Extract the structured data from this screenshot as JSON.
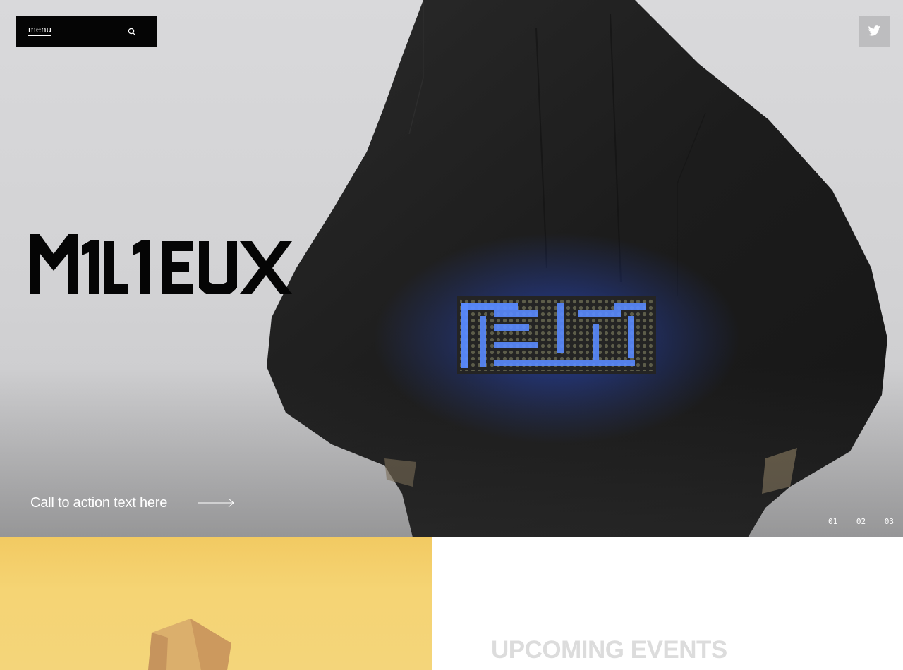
{
  "nav": {
    "menu_label": "menu",
    "search_icon": "search-icon",
    "twitter_icon": "twitter-icon"
  },
  "hero": {
    "logo_text": "MILIEUX",
    "cta_text": "Call to action text here",
    "pagination": [
      "01",
      "02",
      "03"
    ],
    "active_slide": "01",
    "led_sign_text": "FEAS"
  },
  "section": {
    "heading": "UPCOMING EVENTS"
  },
  "colors": {
    "menu_bg": "#050505",
    "hero_bg": "#d6d6d8",
    "jacket": "#1e1e1e",
    "led_blue": "#3f7dff",
    "yellow_panel": "#f4d06a",
    "heading_gray": "#dcdcdc",
    "twitter_bg": "#bdbdbf"
  }
}
